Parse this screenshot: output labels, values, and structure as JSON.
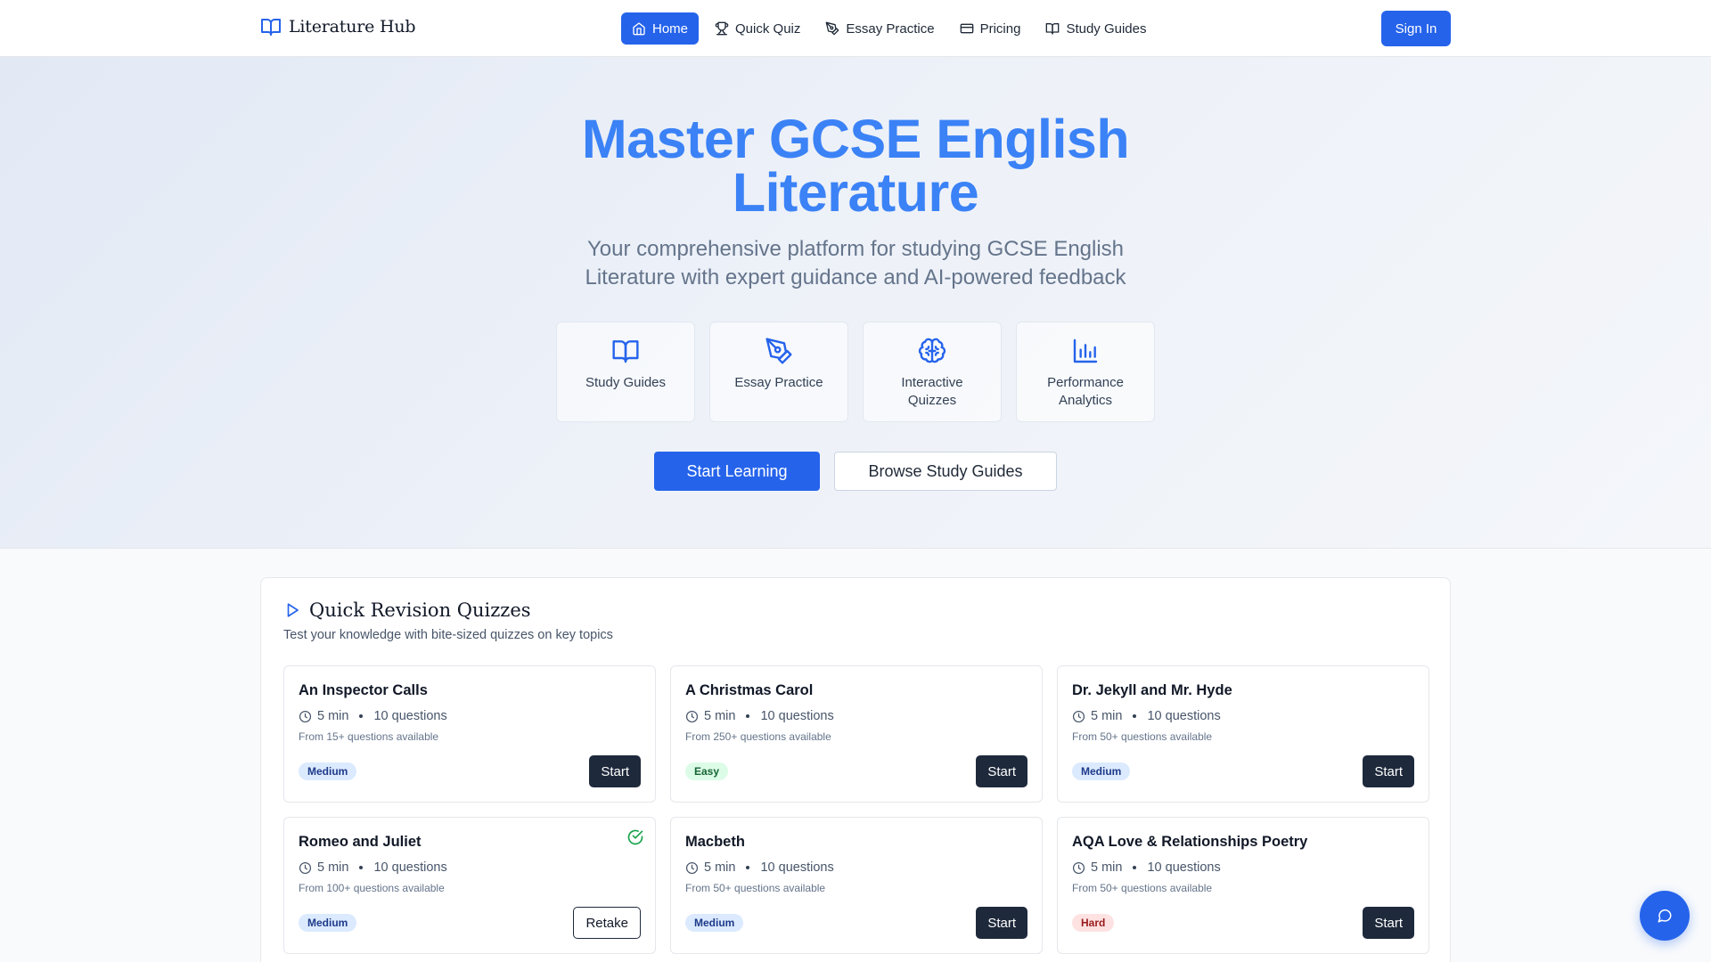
{
  "brand": {
    "name": "Literature Hub",
    "icon": "book-open-icon"
  },
  "nav": {
    "items": [
      {
        "label": "Home",
        "icon": "home-icon",
        "active": true
      },
      {
        "label": "Quick Quiz",
        "icon": "trophy-icon",
        "active": false
      },
      {
        "label": "Essay Practice",
        "icon": "pen-tool-icon",
        "active": false
      },
      {
        "label": "Pricing",
        "icon": "credit-card-icon",
        "active": false
      },
      {
        "label": "Study Guides",
        "icon": "book-open-icon",
        "active": false
      }
    ],
    "sign_in": "Sign In"
  },
  "hero": {
    "title_line1": "Master GCSE English",
    "title_line2": "Literature",
    "subtitle": "Your comprehensive platform for studying GCSE English Literature with expert guidance and AI-powered feedback",
    "features": [
      {
        "label": "Study Guides",
        "icon": "book-open-icon"
      },
      {
        "label": "Essay Practice",
        "icon": "pen-tool-icon"
      },
      {
        "label": "Interactive Quizzes",
        "icon": "brain-icon"
      },
      {
        "label": "Performance Analytics",
        "icon": "bar-chart-icon"
      }
    ],
    "primary_button": "Start Learning",
    "secondary_button": "Browse Study Guides"
  },
  "quizzes": {
    "title": "Quick Revision Quizzes",
    "subtitle": "Test your knowledge with bite-sized quizzes on key topics",
    "cards": [
      {
        "title": "An Inspector Calls",
        "duration": "5 min",
        "questions": "10 questions",
        "available": "From 15+ questions available",
        "difficulty": "Medium",
        "button": "Start",
        "completed": false
      },
      {
        "title": "A Christmas Carol",
        "duration": "5 min",
        "questions": "10 questions",
        "available": "From 250+ questions available",
        "difficulty": "Easy",
        "button": "Start",
        "completed": false
      },
      {
        "title": "Dr. Jekyll and Mr. Hyde",
        "duration": "5 min",
        "questions": "10 questions",
        "available": "From 50+ questions available",
        "difficulty": "Medium",
        "button": "Start",
        "completed": false
      },
      {
        "title": "Romeo and Juliet",
        "duration": "5 min",
        "questions": "10 questions",
        "available": "From 100+ questions available",
        "difficulty": "Medium",
        "button": "Retake",
        "completed": true
      },
      {
        "title": "Macbeth",
        "duration": "5 min",
        "questions": "10 questions",
        "available": "From 50+ questions available",
        "difficulty": "Medium",
        "button": "Start",
        "completed": false
      },
      {
        "title": "AQA Love & Relationships Poetry",
        "duration": "5 min",
        "questions": "10 questions",
        "available": "From 50+ questions available",
        "difficulty": "Hard",
        "button": "Start",
        "completed": false
      }
    ]
  },
  "colors": {
    "primary": "#2563eb",
    "hero_title": "#3b82f6",
    "dark_button": "#1e293b"
  },
  "chat_button": {
    "icon": "message-circle-icon"
  }
}
